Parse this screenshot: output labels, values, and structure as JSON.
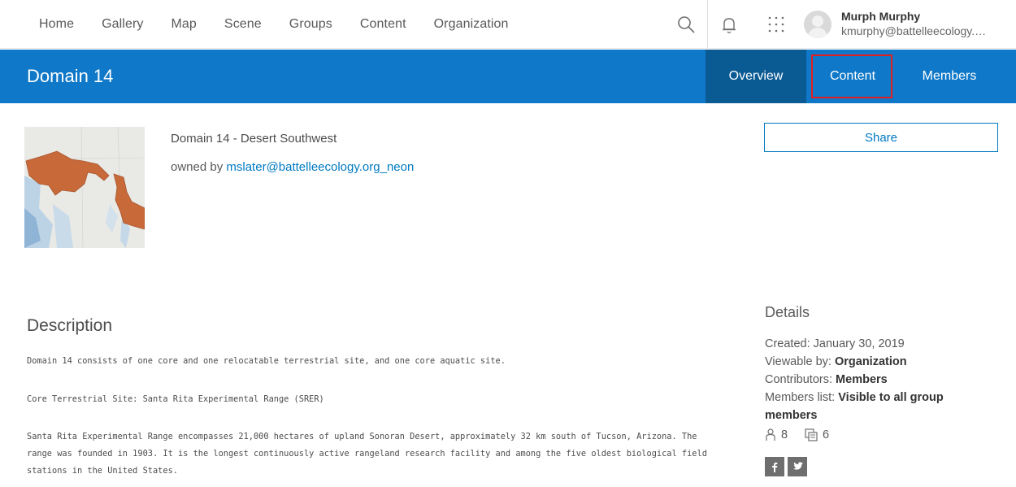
{
  "nav": {
    "links": [
      "Home",
      "Gallery",
      "Map",
      "Scene",
      "Groups",
      "Content",
      "Organization"
    ]
  },
  "user": {
    "name": "Murph Murphy",
    "email": "kmurphy@battelleecology.org"
  },
  "group": {
    "title": "Domain 14",
    "full_name": "Domain 14 - Desert Southwest",
    "owned_by_prefix": "owned by",
    "owner": "mslater@battelleecology.org_neon"
  },
  "tabs": {
    "overview": "Overview",
    "content": "Content",
    "members": "Members"
  },
  "share_label": "Share",
  "description": {
    "heading": "Description",
    "p1": "Domain 14 consists of one core and one relocatable terrestrial site, and one core aquatic site.",
    "p2": "Core Terrestrial Site: Santa Rita Experimental Range (SRER)",
    "p3": "Santa Rita Experimental Range encompasses 21,000 hectares of upland Sonoran Desert, approximately 32 km south of Tucson, Arizona. The range was founded in 1903. It is the longest continuously active rangeland research facility and among the five oldest biological field stations in the United States."
  },
  "details": {
    "heading": "Details",
    "created": "Created: January 30, 2019",
    "viewable_label": "Viewable by:",
    "viewable_value": "Organization",
    "contributors_label": "Contributors:",
    "contributors_value": "Members",
    "members_list_label": "Members list:",
    "members_list_value": "Visible to all group members",
    "member_count": "8",
    "item_count": "6"
  },
  "colors": {
    "banner": "#0f78c8",
    "active_tab": "#0a5a94",
    "link": "#0079c1",
    "highlight": "#e02020"
  },
  "icons": [
    "search-icon",
    "bell-icon",
    "app-launcher-icon",
    "avatar",
    "member-icon",
    "items-icon",
    "facebook-icon",
    "twitter-icon"
  ]
}
